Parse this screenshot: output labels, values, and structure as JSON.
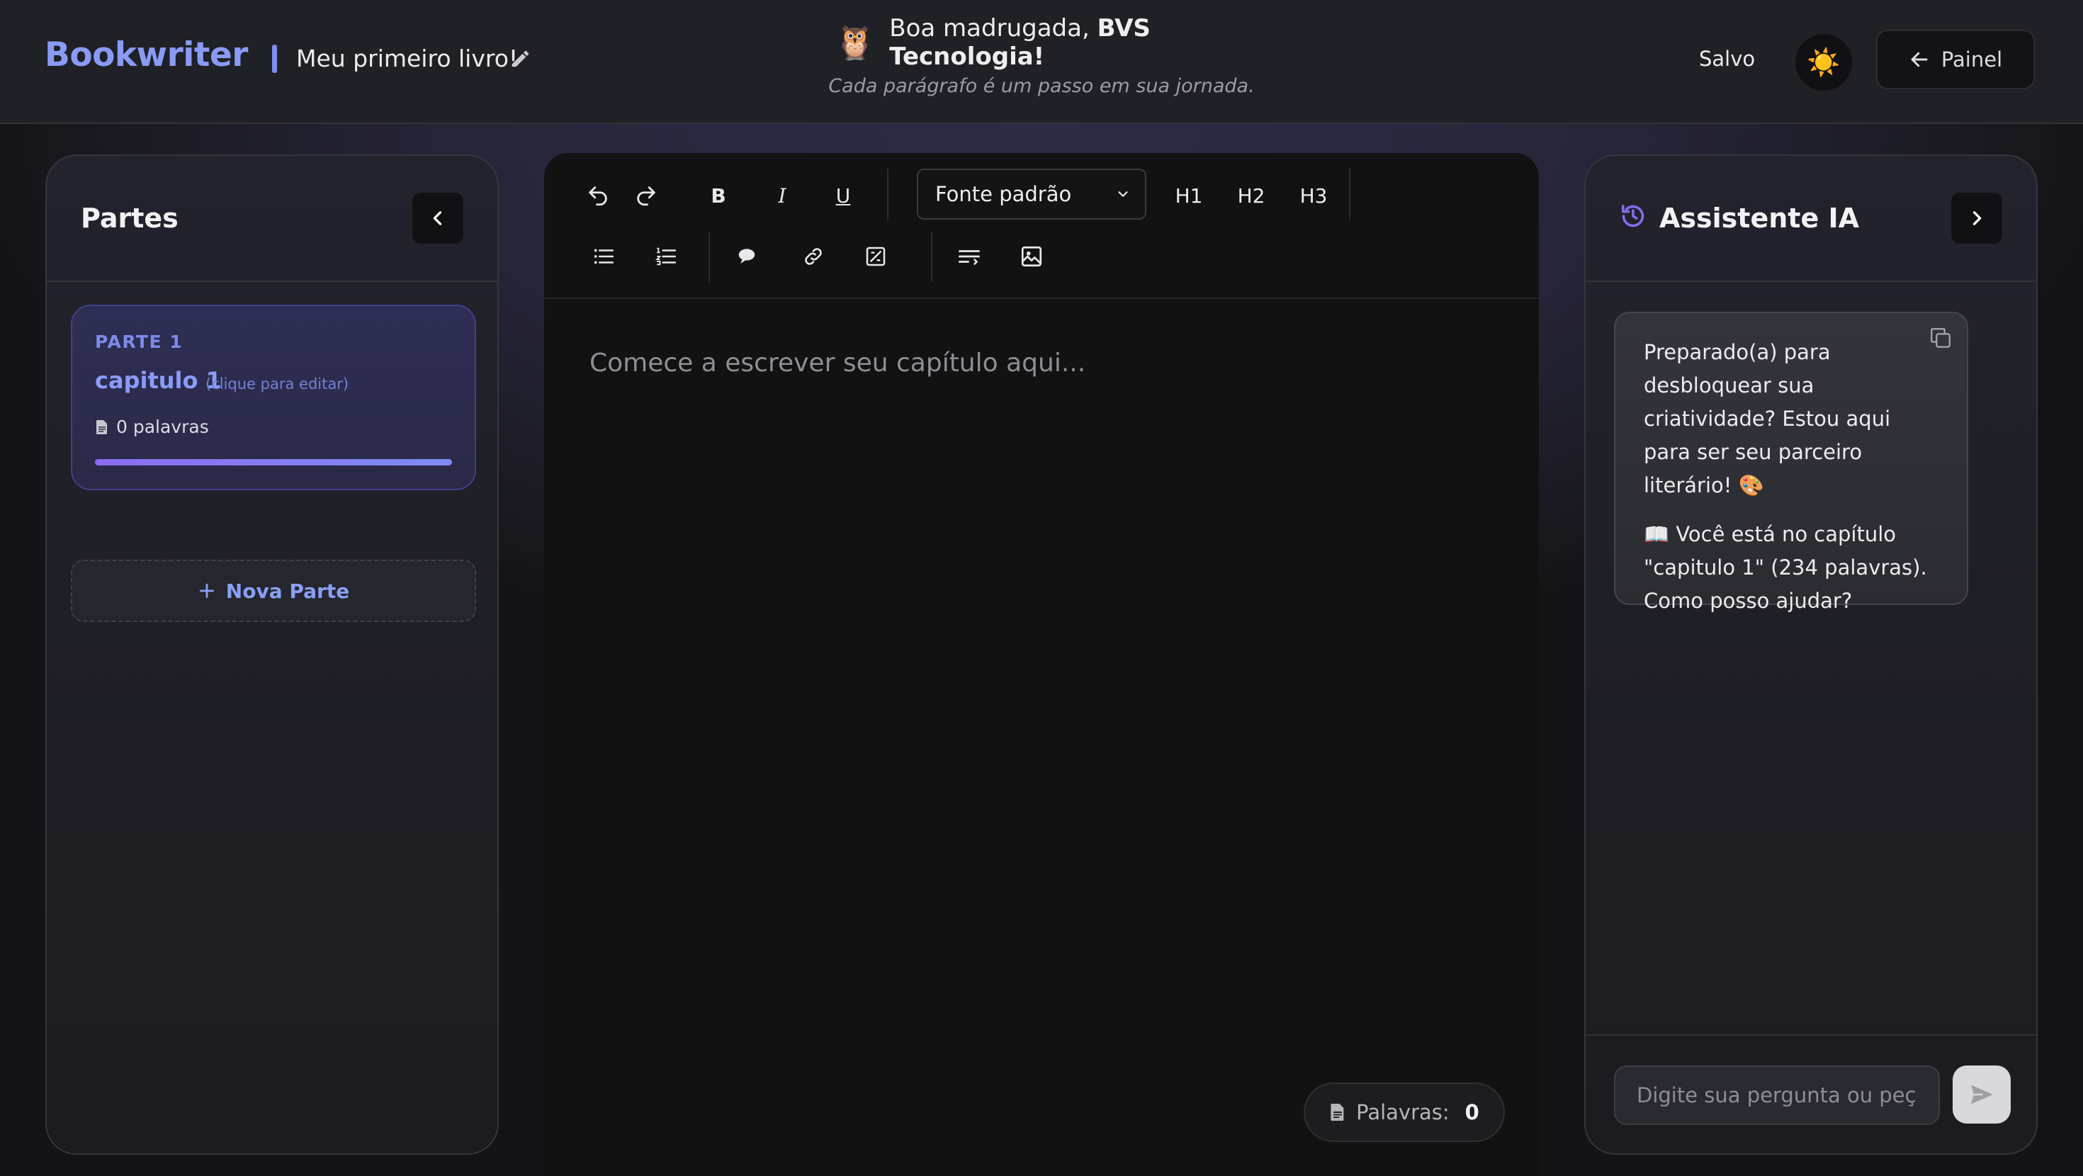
{
  "header": {
    "brand": "Bookwriter",
    "book_title": "Meu primeiro livro!",
    "greeting_prefix": "Boa madrugada, ",
    "greeting_name": "BVS Tecnologia!",
    "owl_emoji": "🦉",
    "subtitle": "Cada parágrafo é um passo em sua jornada.",
    "save_status": "Salvo",
    "theme_emoji": "☀️",
    "panel_button": "Painel"
  },
  "parts_panel": {
    "title": "Partes",
    "parts": [
      {
        "label": "PARTE 1",
        "chapter_name": "capitulo 1",
        "edit_hint": "(clique para editar)",
        "words": "0 palavras",
        "progress": 1.0
      }
    ],
    "new_part_label": "Nova Parte"
  },
  "editor": {
    "toolbar": {
      "font_select": "Fonte padrão",
      "h1": "H1",
      "h2": "H2",
      "h3": "H3",
      "bold": "B",
      "italic": "I",
      "underline": "U"
    },
    "placeholder": "Comece a escrever seu capítulo aqui...",
    "word_count_label": "Palavras:",
    "word_count": "0"
  },
  "assistant": {
    "title": "Assistente IA",
    "message_1": "Preparado(a) para desbloquear sua criatividade? Estou aqui para ser seu parceiro literário! 🎨",
    "message_2": "📖 Você está no capítulo \"capitulo 1\" (234 palavras). Como posso ajudar?",
    "input_placeholder": "Digite sua pergunta ou peça s"
  },
  "colors": {
    "accent": "#8a9bf6",
    "background": "#141416",
    "header": "#202127",
    "editor": "#121212",
    "progress_start": "#8b6cf1",
    "progress_end": "#7f8cf7"
  },
  "icons": [
    "pencil-icon",
    "owl-emoji",
    "sun-icon",
    "arrow-left-icon",
    "chevron-left-icon",
    "chevron-right-icon",
    "file-icon",
    "plus-icon",
    "undo-icon",
    "redo-icon",
    "bullet-list-icon",
    "numbered-list-icon",
    "comment-icon",
    "link-icon",
    "image-edit-icon",
    "text-wrap-icon",
    "image-icon",
    "history-icon",
    "copy-icon",
    "send-icon"
  ]
}
